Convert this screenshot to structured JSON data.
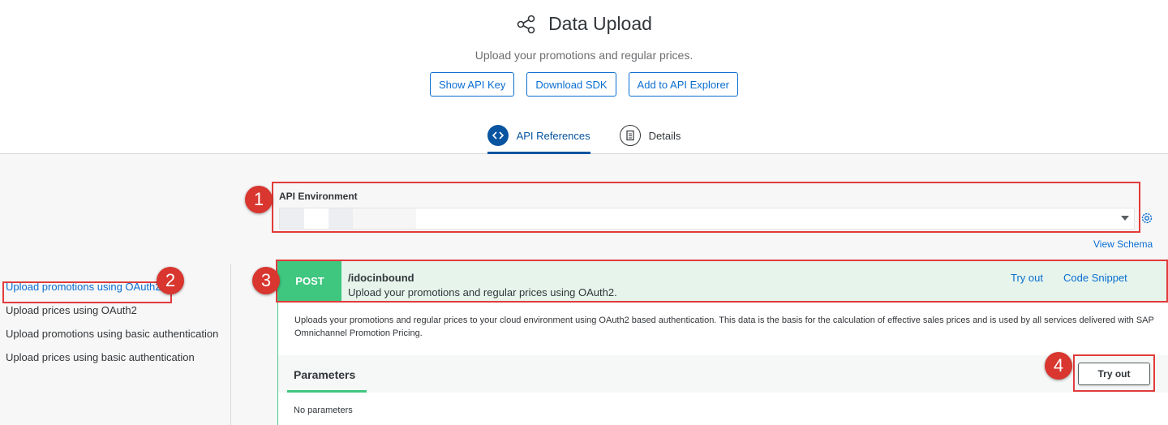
{
  "header": {
    "title": "Data Upload",
    "subtitle": "Upload your promotions and regular prices.",
    "buttons": {
      "show_api_key": "Show API Key",
      "download_sdk": "Download SDK",
      "add_to_explorer": "Add to API Explorer"
    },
    "tabs": [
      {
        "label": "API References",
        "icon": "code-icon",
        "active": true
      },
      {
        "label": "Details",
        "icon": "document-icon",
        "active": false
      }
    ]
  },
  "environment": {
    "label": "API Environment",
    "view_schema": "View Schema"
  },
  "sidebar": {
    "items": [
      {
        "label": "Upload promotions using OAuth2",
        "active": true
      },
      {
        "label": "Upload prices using OAuth2",
        "active": false
      },
      {
        "label": "Upload promotions using basic authentication",
        "active": false
      },
      {
        "label": "Upload prices using basic authentication",
        "active": false
      }
    ]
  },
  "operation": {
    "method": "POST",
    "path": "/idocinbound",
    "summary": "Upload your promotions and regular prices using OAuth2.",
    "try_out_link": "Try out",
    "code_snippet_link": "Code Snippet",
    "description": "Uploads your promotions and regular prices to your cloud environment using OAuth2 based authentication. This data is the basis for the calculation of effective sales prices and is used by all services delivered with SAP Omnichannel Promotion Pricing.",
    "parameters_title": "Parameters",
    "try_out_button": "Try out",
    "no_parameters": "No parameters"
  },
  "annotations": {
    "markers": [
      "1",
      "2",
      "3",
      "4"
    ]
  },
  "colors": {
    "accent": "#0a6ed1",
    "post_green": "#3fc67f",
    "highlight_red": "#e23b3b"
  }
}
